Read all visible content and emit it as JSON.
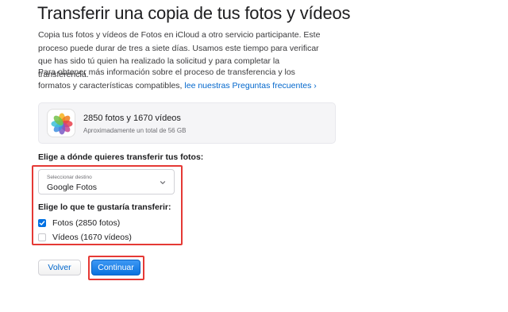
{
  "page": {
    "title": "Transferir una copia de tus fotos y vídeos",
    "intro": "Copia tus fotos y vídeos de Fotos en iCloud a otro servicio participante. Este proceso puede durar de tres a siete días. Usamos este tiempo para verificar que has sido tú quien ha realizado la solicitud y para completar la transferencia.",
    "info_prefix": "Para obtener más información sobre el proceso de transferencia y los formatos y características compatibles, ",
    "info_link": "lee nuestras Preguntas frecuentes ›"
  },
  "summary": {
    "icon": "photos-app-icon",
    "count": "2850 fotos y 1670 vídeos",
    "size": "Aproximadamente un total de 56 GB"
  },
  "destination": {
    "label": "Elige a dónde quieres transferir tus fotos:",
    "placeholder": "Seleccionar destino",
    "value": "Google Fotos"
  },
  "content": {
    "label": "Elige lo que te gustaría transferir:",
    "options": [
      {
        "label": "Fotos (2850 fotos)",
        "checked": true
      },
      {
        "label": "Vídeos (1670 vídeos)",
        "checked": false
      }
    ]
  },
  "buttons": {
    "back": "Volver",
    "continue": "Continuar"
  },
  "colors": {
    "accent": "#0071e3",
    "link": "#0066cc",
    "highlight": "#e53935"
  }
}
